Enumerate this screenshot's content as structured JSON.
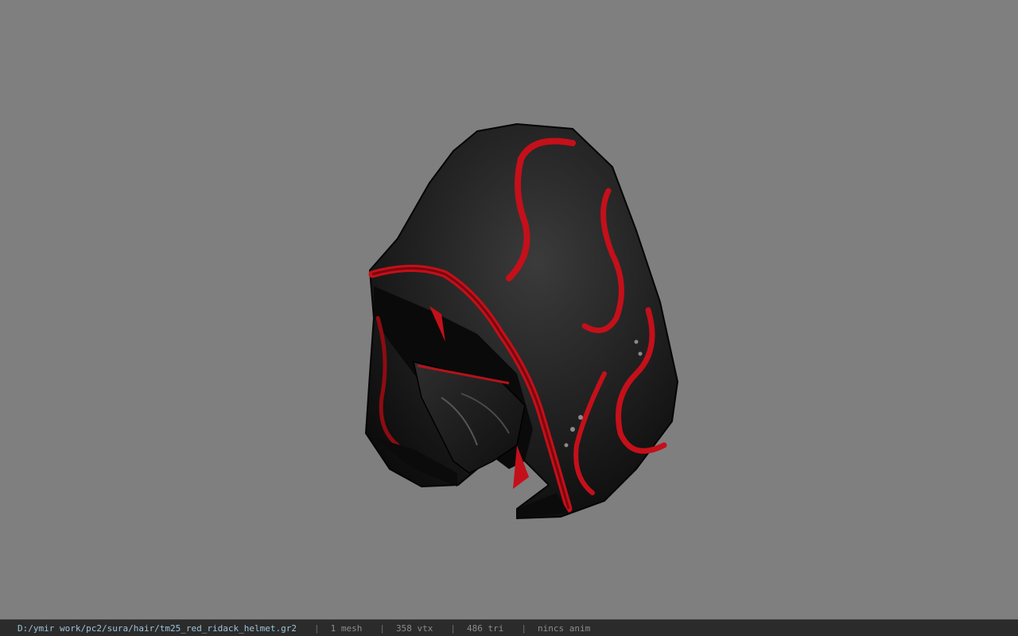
{
  "viewer": {
    "background_color": "#7f7f7f",
    "model_name": "red hooded helmet model"
  },
  "statusbar": {
    "file_path": "D:/ymir work/pc2/sura/hair/tm25_red_ridack_helmet.gr2",
    "separator": "|",
    "mesh_count": "1 mesh",
    "vertex_count": "358 vtx",
    "triangle_count": "486 tri",
    "anim_status": "nincs anim"
  }
}
